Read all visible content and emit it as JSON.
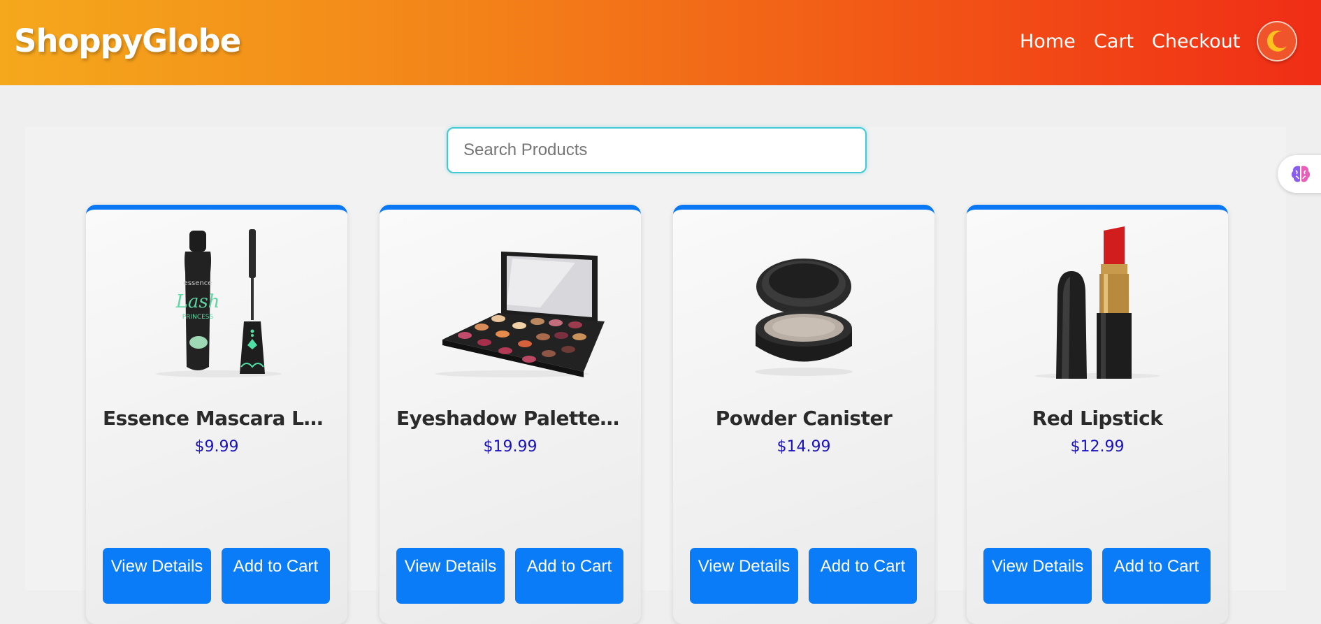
{
  "header": {
    "brand": "ShoppyGlobe",
    "nav": [
      {
        "label": "Home"
      },
      {
        "label": "Cart"
      },
      {
        "label": "Checkout"
      }
    ],
    "theme_icon": "moon-icon"
  },
  "search": {
    "placeholder": "Search Products",
    "value": ""
  },
  "side_widget_icon": "brain-icon",
  "products": [
    {
      "title": "Essence Mascara Lash...",
      "price": "$9.99",
      "image": "mascara",
      "view_label": "View Details",
      "add_label": "Add to Cart"
    },
    {
      "title": "Eyeshadow Palette wi...",
      "price": "$19.99",
      "image": "eyeshadow-palette",
      "view_label": "View Details",
      "add_label": "Add to Cart"
    },
    {
      "title": "Powder Canister",
      "price": "$14.99",
      "image": "powder-canister",
      "view_label": "View Details",
      "add_label": "Add to Cart"
    },
    {
      "title": "Red Lipstick",
      "price": "$12.99",
      "image": "red-lipstick",
      "view_label": "View Details",
      "add_label": "Add to Cart"
    }
  ],
  "colors": {
    "header_gradient_start": "#f5a81c",
    "header_gradient_end": "#f02d16",
    "accent_blue": "#0a78f5",
    "price_color": "#1a12b8",
    "search_border": "#41c9d6"
  }
}
